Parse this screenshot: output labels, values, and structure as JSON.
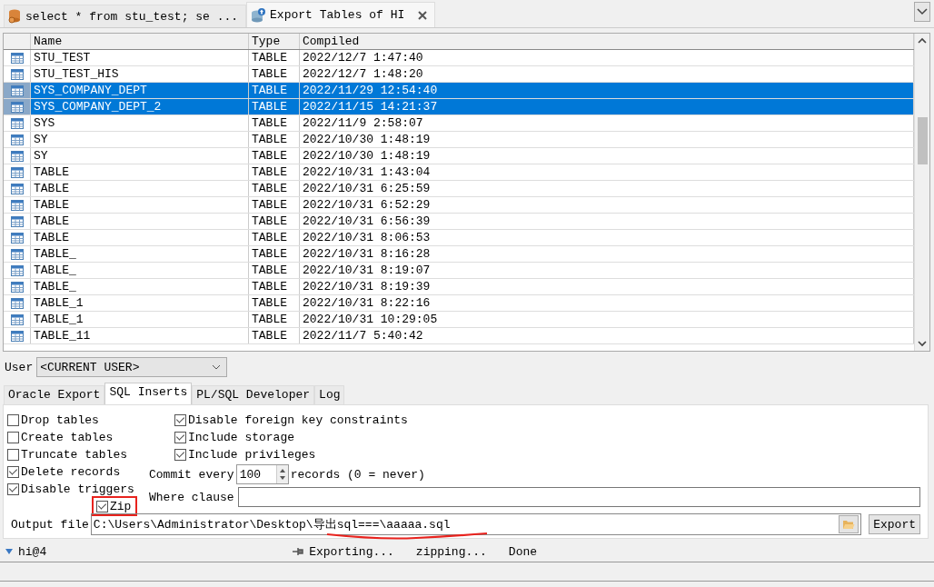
{
  "doc_tabs": [
    {
      "label": "select * from stu_test; se ...",
      "kind": "sql",
      "selected": false,
      "closable": false
    },
    {
      "label": "Export Tables of HI",
      "kind": "export",
      "selected": true,
      "closable": true
    }
  ],
  "table": {
    "columns": [
      "Name",
      "Type",
      "Compiled"
    ],
    "rows": [
      {
        "name": "STU_TEST",
        "type": "TABLE",
        "compiled": "2022/12/7 1:47:40",
        "selected": false
      },
      {
        "name": "STU_TEST_HIS",
        "type": "TABLE",
        "compiled": "2022/12/7 1:48:20",
        "selected": false
      },
      {
        "name": "SYS_COMPANY_DEPT",
        "type": "TABLE",
        "compiled": "2022/11/29 12:54:40",
        "selected": true
      },
      {
        "name": "SYS_COMPANY_DEPT_2",
        "type": "TABLE",
        "compiled": "2022/11/15 14:21:37",
        "selected": true
      },
      {
        "name": "SYS",
        "type": "TABLE",
        "compiled": "2022/11/9 2:58:07",
        "selected": false
      },
      {
        "name": "SY",
        "type": "TABLE",
        "compiled": "2022/10/30 1:48:19",
        "selected": false
      },
      {
        "name": "SY",
        "type": "TABLE",
        "compiled": "2022/10/30 1:48:19",
        "selected": false
      },
      {
        "name": "TABLE",
        "type": "TABLE",
        "compiled": "2022/10/31 1:43:04",
        "selected": false
      },
      {
        "name": "TABLE",
        "type": "TABLE",
        "compiled": "2022/10/31 6:25:59",
        "selected": false
      },
      {
        "name": "TABLE",
        "type": "TABLE",
        "compiled": "2022/10/31 6:52:29",
        "selected": false
      },
      {
        "name": "TABLE",
        "type": "TABLE",
        "compiled": "2022/10/31 6:56:39",
        "selected": false
      },
      {
        "name": "TABLE",
        "type": "TABLE",
        "compiled": "2022/10/31 8:06:53",
        "selected": false
      },
      {
        "name": "TABLE_",
        "type": "TABLE",
        "compiled": "2022/10/31 8:16:28",
        "selected": false
      },
      {
        "name": "TABLE_",
        "type": "TABLE",
        "compiled": "2022/10/31 8:19:07",
        "selected": false
      },
      {
        "name": "TABLE_",
        "type": "TABLE",
        "compiled": "2022/10/31 8:19:39",
        "selected": false
      },
      {
        "name": "TABLE_1",
        "type": "TABLE",
        "compiled": "2022/10/31 8:22:16",
        "selected": false
      },
      {
        "name": "TABLE_1",
        "type": "TABLE",
        "compiled": "2022/10/31 10:29:05",
        "selected": false
      },
      {
        "name": "TABLE_11",
        "type": "TABLE",
        "compiled": "2022/11/7 5:40:42",
        "selected": false
      }
    ]
  },
  "user": {
    "label": "User",
    "value": "<CURRENT USER>"
  },
  "option_tabs": [
    {
      "label": "Oracle Export",
      "selected": false
    },
    {
      "label": "SQL Inserts",
      "selected": true
    },
    {
      "label": "PL/SQL Developer",
      "selected": false
    },
    {
      "label": "Log",
      "selected": false
    }
  ],
  "left_options": [
    {
      "label": "Drop tables",
      "checked": false
    },
    {
      "label": "Create tables",
      "checked": false
    },
    {
      "label": "Truncate tables",
      "checked": false
    },
    {
      "label": "Delete records",
      "checked": true
    },
    {
      "label": "Disable triggers",
      "checked": true
    }
  ],
  "right_options": [
    {
      "label": "Disable foreign key constraints",
      "checked": true
    },
    {
      "label": "Include storage",
      "checked": true
    },
    {
      "label": "Include privileges",
      "checked": true
    }
  ],
  "commit": {
    "label": "Commit every",
    "value": "100",
    "suffix": "records (0 = never)"
  },
  "where": {
    "label": "Where clause"
  },
  "zip": {
    "label": "Zip",
    "checked": true,
    "highlighted": true
  },
  "output": {
    "label": "Output file",
    "value": "C:\\Users\\Administrator\\Desktop\\导出sql===\\aaaaa.sql",
    "underlined": true
  },
  "export_button": "Export",
  "status": {
    "connection": "hi@4",
    "steps": [
      "Exporting...",
      "zipping...",
      "Done"
    ]
  }
}
